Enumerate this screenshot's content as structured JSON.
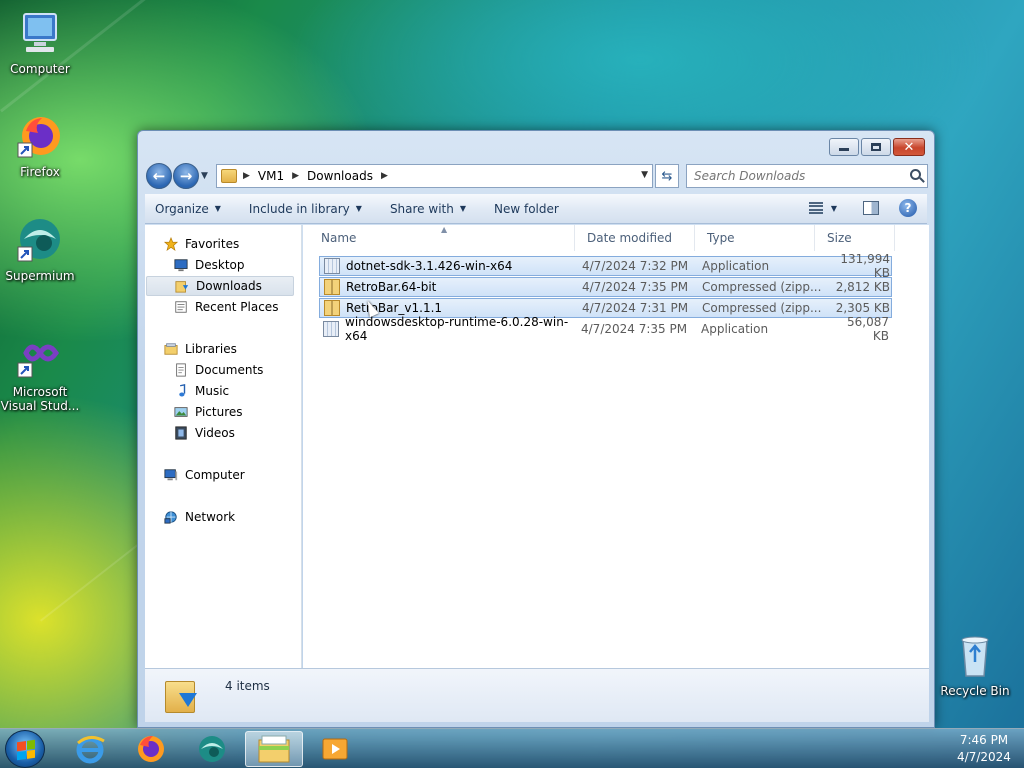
{
  "desktop": {
    "icons": [
      {
        "label": "Computer",
        "icon": "computer-icon"
      },
      {
        "label": "Firefox",
        "icon": "firefox-icon"
      },
      {
        "label": "Supermium",
        "icon": "supermium-icon"
      },
      {
        "label": "Microsoft Visual Stud...",
        "icon": "visual-studio-icon"
      },
      {
        "label": "Recycle Bin",
        "icon": "recycle-bin-icon"
      }
    ]
  },
  "window": {
    "address": {
      "crumbs": [
        "VM1",
        "Downloads"
      ]
    },
    "search_placeholder": "Search Downloads",
    "toolbar": {
      "organize": "Organize",
      "include_in_library": "Include in library",
      "share_with": "Share with",
      "new_folder": "New folder"
    },
    "nav": {
      "favorites": "Favorites",
      "desktop": "Desktop",
      "downloads": "Downloads",
      "recent_places": "Recent Places",
      "libraries": "Libraries",
      "documents": "Documents",
      "music": "Music",
      "pictures": "Pictures",
      "videos": "Videos",
      "computer": "Computer",
      "network": "Network"
    },
    "columns": {
      "name": "Name",
      "date": "Date modified",
      "type": "Type",
      "size": "Size"
    },
    "files": [
      {
        "name": "dotnet-sdk-3.1.426-win-x64",
        "date": "4/7/2024 7:32 PM",
        "type": "Application",
        "size": "131,994 KB",
        "selected": true,
        "icon": "application-icon"
      },
      {
        "name": "RetroBar.64-bit",
        "date": "4/7/2024 7:35 PM",
        "type": "Compressed (zipp...",
        "size": "2,812 KB",
        "selected": true,
        "icon": "zip-folder-icon"
      },
      {
        "name": "RetroBar_v1.1.1",
        "date": "4/7/2024 7:31 PM",
        "type": "Compressed (zipp...",
        "size": "2,305 KB",
        "selected": true,
        "icon": "zip-folder-icon"
      },
      {
        "name": "windowsdesktop-runtime-6.0.28-win-x64",
        "date": "4/7/2024 7:35 PM",
        "type": "Application",
        "size": "56,087 KB",
        "selected": false,
        "icon": "application-icon"
      }
    ],
    "status": {
      "item_count": "4 items"
    }
  },
  "taskbar": {
    "time": "7:46 PM",
    "date": "4/7/2024"
  }
}
